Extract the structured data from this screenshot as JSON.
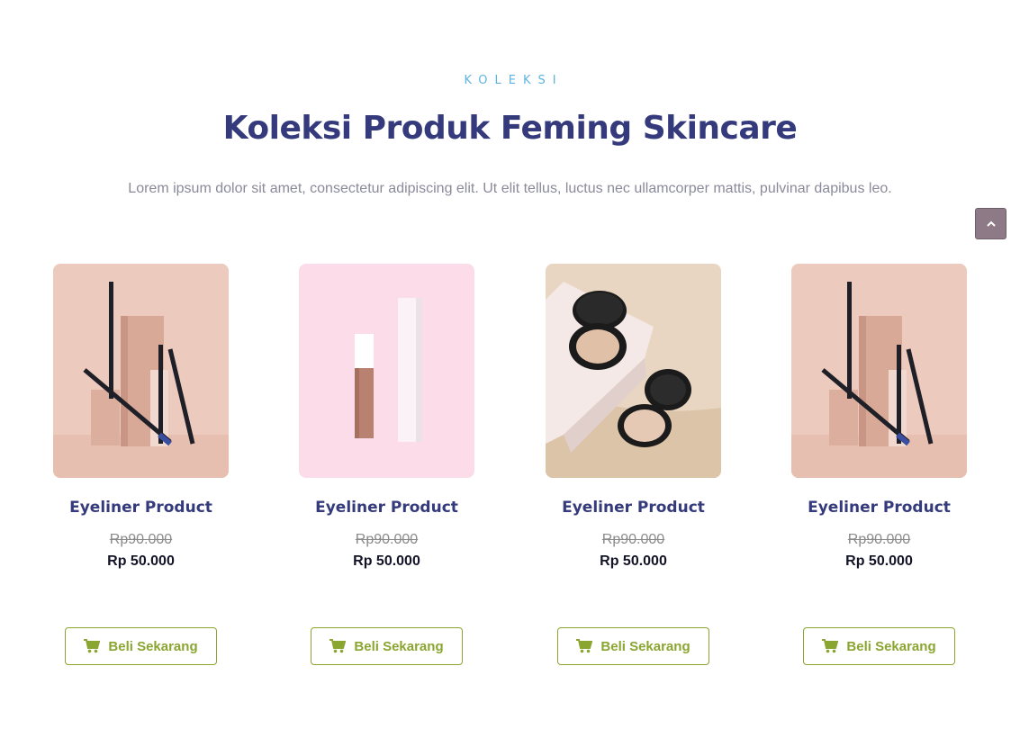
{
  "section": {
    "eyebrow": "KOLEKSI",
    "title": "Koleksi Produk Feming Skincare",
    "subtitle": "Lorem ipsum dolor sit amet, consectetur adipiscing elit. Ut elit tellus, luctus nec ullamcorper mattis, pulvinar dapibus leo."
  },
  "scroll_top": {
    "icon": "chevron-up-icon"
  },
  "products": [
    {
      "name": "Eyeliner Product",
      "old_price": "Rp90.000",
      "price": "Rp 50.000",
      "button": "Beli Sekarang",
      "image": "eyeliner-pencils-photo"
    },
    {
      "name": "Eyeliner Product",
      "old_price": "Rp90.000",
      "price": "Rp 50.000",
      "button": "Beli Sekarang",
      "image": "liquid-foundation-photo"
    },
    {
      "name": "Eyeliner Product",
      "old_price": "Rp90.000",
      "price": "Rp 50.000",
      "button": "Beli Sekarang",
      "image": "compact-powder-photo"
    },
    {
      "name": "Eyeliner Product",
      "old_price": "Rp90.000",
      "price": "Rp 50.000",
      "button": "Beli Sekarang",
      "image": "eyeliner-pencils-photo"
    }
  ],
  "colors": {
    "eyebrow": "#5fb3e0",
    "title": "#343a7c",
    "button_accent": "#8aa530"
  }
}
